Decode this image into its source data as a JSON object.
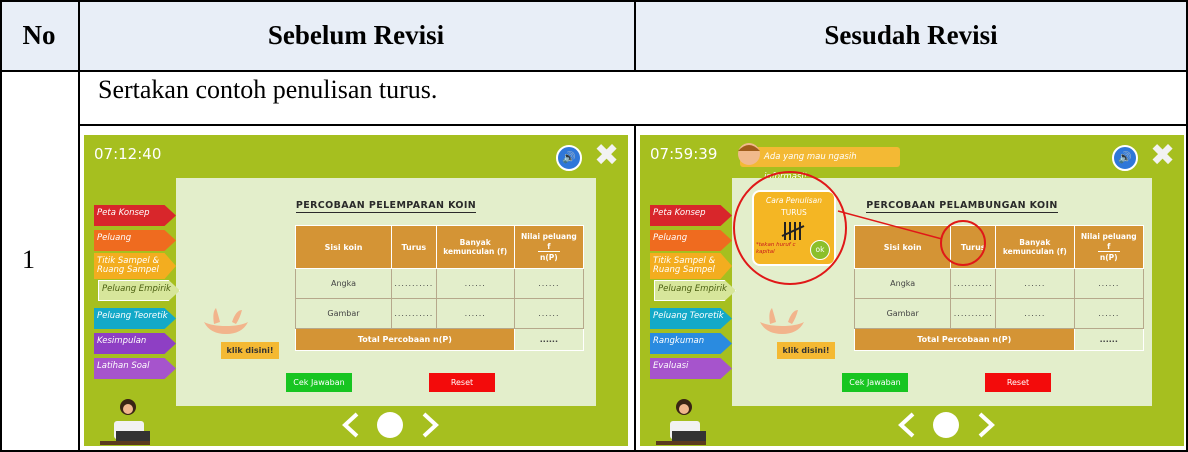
{
  "table": {
    "col_no": "No",
    "col_before": "Sebelum Revisi",
    "col_after": "Sesudah Revisi",
    "row_number": "1",
    "row_note": "Sertakan contoh penulisan turus."
  },
  "before": {
    "time": "07:12:40",
    "title": "PERCOBAAN PELEMPARAN KOIN",
    "tabs": [
      {
        "label": "Peta Konsep",
        "color": "#d8262b"
      },
      {
        "label": "Peluang",
        "color": "#ef6b1f"
      },
      {
        "label": "Titik Sampel & Ruang Sampel",
        "color": "#f3ad1f"
      },
      {
        "label": "Peluang Empirik",
        "color": "#d7e69b"
      },
      {
        "label": "Peluang Teoretik",
        "color": "#13a9c8"
      },
      {
        "label": "Kesimpulan",
        "color": "#8e3fc4"
      },
      {
        "label": "Latihan Soal",
        "color": "#a654cc"
      }
    ],
    "table_headers": [
      "Sisi koin",
      "Turus",
      "Banyak kemunculan (f)",
      "Nilai peluang",
      "f",
      "n(P)"
    ],
    "rows": [
      {
        "label": "Angka",
        "turus": "...........",
        "f": "......",
        "p": "......"
      },
      {
        "label": "Gambar",
        "turus": "...........",
        "f": "......",
        "p": "......"
      }
    ],
    "total_label": "Total Percobaan n(P)",
    "total_value": "......",
    "klik": "klik disini!",
    "check_button": "Cek Jawaban",
    "reset_button": "Reset"
  },
  "after": {
    "time": "07:59:39",
    "banner": "Ada yang mau ngasih informasi!",
    "title": "PERCOBAAN PELAMBUNGAN KOIN",
    "tabs": [
      {
        "label": "Peta Konsep",
        "color": "#d8262b"
      },
      {
        "label": "Peluang",
        "color": "#ef6b1f"
      },
      {
        "label": "Titik Sampel & Ruang Sampel",
        "color": "#f3ad1f"
      },
      {
        "label": "Peluang Empirik",
        "color": "#d7e69b"
      },
      {
        "label": "Peluang Teoretik",
        "color": "#13a9c8"
      },
      {
        "label": "Rangkuman",
        "color": "#2a8be0"
      },
      {
        "label": "Evaluasi",
        "color": "#a654cc"
      }
    ],
    "popup_title": "Cara Penulisan",
    "popup_sub": "TURUS",
    "popup_note": "*tekan huruf c kapital",
    "popup_ok": "ok",
    "table_headers": [
      "Sisi koin",
      "Turus",
      "Banyak kemunculan (f)",
      "Nilai peluang",
      "f",
      "n(P)"
    ],
    "rows": [
      {
        "label": "Angka",
        "turus": "...........",
        "f": "......",
        "p": "......"
      },
      {
        "label": "Gambar",
        "turus": "...........",
        "f": "......",
        "p": "......"
      }
    ],
    "total_label": "Total Percobaan n(P)",
    "total_value": "......",
    "klik": "klik disini!",
    "check_button": "Cek Jawaban",
    "reset_button": "Reset"
  },
  "icons": [
    "speaker-icon",
    "close-icon",
    "prev-arrow-icon",
    "home-circle-icon",
    "next-arrow-icon",
    "hand-icon",
    "person-at-laptop-icon",
    "tally-marks-icon",
    "annotation-circle-icon"
  ]
}
